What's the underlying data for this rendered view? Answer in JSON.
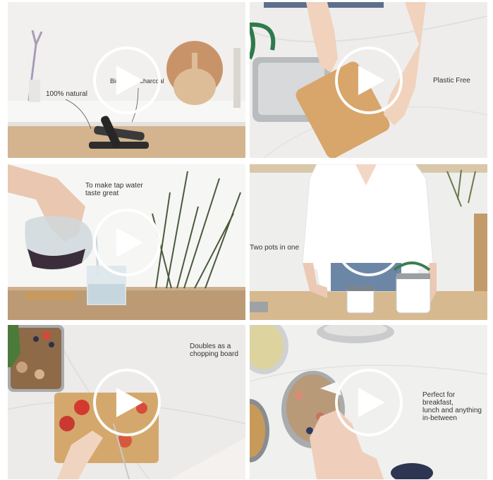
{
  "videos": [
    {
      "caption_1": "100% natural",
      "caption_2": "Binchotan charcoal",
      "play_icon": "play-icon"
    },
    {
      "caption_1": "Plastic Free",
      "play_icon": "play-icon"
    },
    {
      "caption_1": "To make tap water\ntaste great",
      "play_icon": "play-icon"
    },
    {
      "caption_1": "Two pots in one",
      "play_icon": "play-icon"
    },
    {
      "caption_1": "Doubles as a\nchopping board",
      "play_icon": "play-icon"
    },
    {
      "caption_1": "Perfect for breakfast,\nlunch and anything\nin-between",
      "play_icon": "play-icon"
    }
  ],
  "colors": {
    "play_ring": "#ffffff",
    "wood": "#c8955a",
    "marble": "#eceae7"
  }
}
